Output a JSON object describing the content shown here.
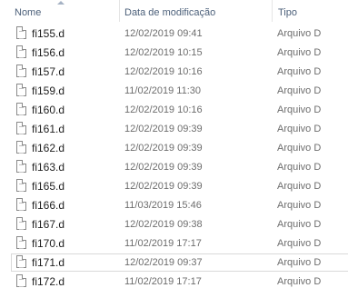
{
  "columns": {
    "name": "Nome",
    "date": "Data de modificação",
    "type": "Tipo"
  },
  "files": [
    {
      "name": "fi155.d",
      "date": "12/02/2019 09:41",
      "type": "Arquivo D"
    },
    {
      "name": "fi156.d",
      "date": "12/02/2019 10:15",
      "type": "Arquivo D"
    },
    {
      "name": "fi157.d",
      "date": "12/02/2019 10:16",
      "type": "Arquivo D"
    },
    {
      "name": "fi159.d",
      "date": "11/02/2019 11:30",
      "type": "Arquivo D"
    },
    {
      "name": "fi160.d",
      "date": "12/02/2019 10:16",
      "type": "Arquivo D"
    },
    {
      "name": "fi161.d",
      "date": "12/02/2019 09:39",
      "type": "Arquivo D"
    },
    {
      "name": "fi162.d",
      "date": "12/02/2019 09:39",
      "type": "Arquivo D"
    },
    {
      "name": "fi163.d",
      "date": "12/02/2019 09:39",
      "type": "Arquivo D"
    },
    {
      "name": "fi165.d",
      "date": "12/02/2019 09:39",
      "type": "Arquivo D"
    },
    {
      "name": "fi166.d",
      "date": "11/03/2019 15:46",
      "type": "Arquivo D"
    },
    {
      "name": "fi167.d",
      "date": "12/02/2019 09:38",
      "type": "Arquivo D"
    },
    {
      "name": "fi170.d",
      "date": "11/02/2019 17:17",
      "type": "Arquivo D"
    },
    {
      "name": "fi171.d",
      "date": "12/02/2019 09:37",
      "type": "Arquivo D",
      "selected": true
    },
    {
      "name": "fi172.d",
      "date": "11/02/2019 17:17",
      "type": "Arquivo D"
    }
  ],
  "icons": {
    "file": "file-icon",
    "sort": "sort-ascending-icon"
  }
}
